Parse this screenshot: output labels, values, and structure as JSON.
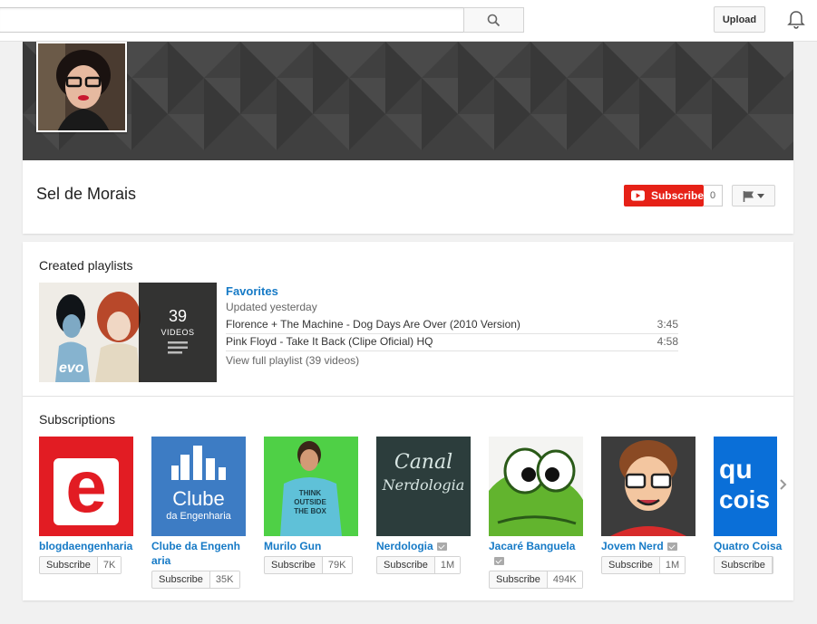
{
  "header": {
    "search_placeholder": "",
    "upload_label": "Upload"
  },
  "channel": {
    "name": "Sel de Morais",
    "subscribe_label": "Subscribe",
    "subscriber_count": "0"
  },
  "playlists": {
    "section_title": "Created playlists",
    "items": [
      {
        "title": "Favorites",
        "updated": "Updated yesterday",
        "count": "39",
        "count_label": "VIDEOS",
        "thumb_badge": "evo",
        "videos": [
          {
            "title": "Florence + The Machine - Dog Days Are Over (2010 Version)",
            "duration": "3:45"
          },
          {
            "title": "Pink Floyd - Take It Back (Clipe Oficial) HQ",
            "duration": "4:58"
          }
        ],
        "view_all": "View full playlist (39 videos)"
      }
    ]
  },
  "subscriptions": {
    "section_title": "Subscriptions",
    "items": [
      {
        "name": "blogdaengenharia",
        "subscribe_label": "Subscribe",
        "count": "7K",
        "verified": false,
        "thumb_text": "e"
      },
      {
        "name": "Clube da Engenharia",
        "subscribe_label": "Subscribe",
        "count": "35K",
        "verified": false,
        "thumb_text": "Clube",
        "thumb_sub": "da Engenharia"
      },
      {
        "name": "Murilo Gun",
        "subscribe_label": "Subscribe",
        "count": "79K",
        "verified": false,
        "thumb_text": "THINK OUTSIDE THE BOX"
      },
      {
        "name": "Nerdologia",
        "subscribe_label": "Subscribe",
        "count": "1M",
        "verified": true,
        "thumb_text": "Canal",
        "thumb_sub": "Nerdologia"
      },
      {
        "name": "Jacaré Banguela",
        "subscribe_label": "Subscribe",
        "count": "494K",
        "verified": true
      },
      {
        "name": "Jovem Nerd",
        "subscribe_label": "Subscribe",
        "count": "1M",
        "verified": true
      },
      {
        "name": "Quatro Coisas",
        "subscribe_label": "Subscribe",
        "count": "",
        "verified": false,
        "thumb_text": "qu",
        "thumb_sub": "cois"
      }
    ]
  },
  "colors": {
    "accent": "#167ac6",
    "subscribe_red": "#e62117"
  }
}
